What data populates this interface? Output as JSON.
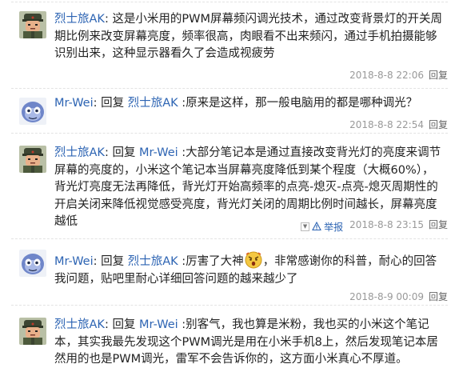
{
  "comments": [
    {
      "user": "烈士旅AK",
      "colon": ": ",
      "text": "这是小米用的PWM屏幕频闪调光技术，通过改变背景灯的开关周期比例来改变屏幕亮度，频率很高，肉眼看不出来频闪，通过手机拍摄能够识别出来，这种显示器看久了会造成视疲劳",
      "timestamp": "2018-8-8 22:06",
      "reply": "回复",
      "avatar": "soldier"
    },
    {
      "user": "Mr-Wei",
      "colon": ": ",
      "reply_prefix": "回复 ",
      "reply_to": "烈士旅AK",
      "text": " :原来是这样，那一般电脑用的都是哪种调光？",
      "timestamp": "2018-8-8 22:54",
      "reply": "回复",
      "avatar": "robot"
    },
    {
      "user": "烈士旅AK",
      "colon": ": ",
      "reply_prefix": "回复 ",
      "reply_to": "Mr-Wei",
      "text": " :大部分笔记本是通过直接改变背光灯的亮度来调节屏幕的亮度的，小米这个笔记本当屏幕亮度降低到某个程度（大概60%），背光灯亮度无法再降低，背光灯开始高频率的点亮-熄灭-点亮-熄灭周期性的开启关闭来降低视觉感受亮度，背光灯关闭的周期比例时间越长，屏幕亮度越低",
      "report": "举报",
      "timestamp": "2018-8-8 23:15",
      "reply": "回复",
      "avatar": "soldier"
    },
    {
      "user": "Mr-Wei",
      "colon": ": ",
      "reply_prefix": "回复 ",
      "reply_to": "烈士旅AK",
      "text_before_emoji": " :厉害了大神",
      "text_after_emoji": "，非常感谢你的科普，耐心的回答我问题，贴吧里耐心详细回答问题的越来越少了",
      "timestamp": "2018-8-9 00:09",
      "reply": "回复",
      "avatar": "robot"
    },
    {
      "user": "烈士旅AK",
      "colon": ": ",
      "reply_prefix": "回复 ",
      "reply_to": "Mr-Wei",
      "text": " :别客气，我也算是米粉，我也买的小米这个笔记本，其实我最先发现这个PWM调光是用在小米手机8上，然后发现笔记本居然用的也是PWM调光，雷军不会告诉你的，这方面小米真心不厚道。",
      "avatar": "soldier"
    }
  ],
  "colors": {
    "link": "#2d64b3",
    "meta": "#999999",
    "text": "#222222"
  },
  "icons": {
    "soldier_avatar": "soldier-avatar",
    "robot_avatar": "robot-avatar",
    "emoji": "shocked-emoji",
    "report": "warning-icon",
    "dropdown": "dropdown-icon"
  }
}
